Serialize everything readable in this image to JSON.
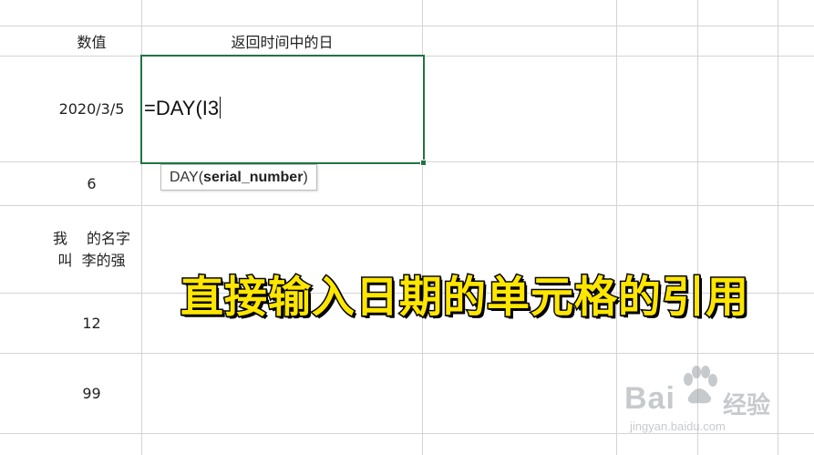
{
  "sheet": {
    "header_values": "数值",
    "header_return_day": "返回时间中的日",
    "row1_value": "2020/3/5",
    "row2_value": "6",
    "row3_line1": "我　 的名字",
    "row3_line2": "叫  李的强",
    "row4_value": "12",
    "row5_value": "99"
  },
  "active_cell": {
    "formula": "=DAY(I3",
    "accent_color": "#217346"
  },
  "tooltip": {
    "func_name": "DAY(",
    "arg": "serial_number",
    "close": ")"
  },
  "caption": {
    "text": "直接输入日期的单元格的引用",
    "color": "#ffe600"
  },
  "watermark": {
    "brand": "Bai",
    "brand_suffix": "经验",
    "url": "jingyan.baidu.com",
    "icon": "baidu-paw-icon"
  }
}
